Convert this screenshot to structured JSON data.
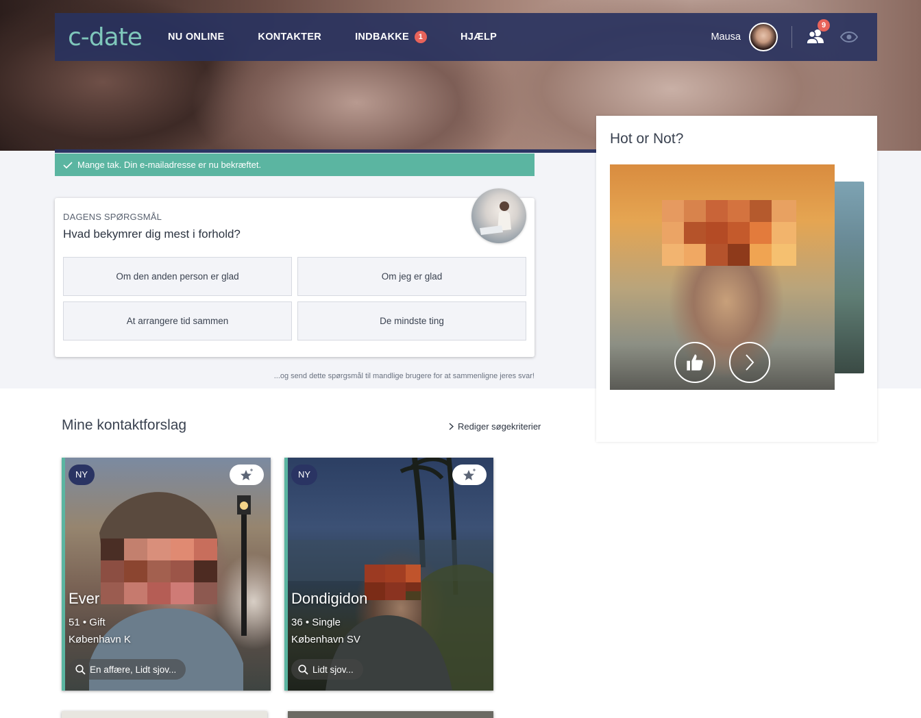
{
  "brand": {
    "logo": "c-date"
  },
  "nav": {
    "items": [
      {
        "label": "NU ONLINE"
      },
      {
        "label": "KONTAKTER"
      },
      {
        "label": "INDBAKKE",
        "badge": "1"
      },
      {
        "label": "HJÆLP"
      }
    ],
    "user_name": "Mausa",
    "contacts_badge": "9",
    "icons": [
      "contacts-icon",
      "eye-icon"
    ]
  },
  "success_banner": {
    "text": "Mange tak. Din e-mailadresse er nu bekræftet."
  },
  "question": {
    "label": "DAGENS SPØRGSMÅL",
    "text": "Hvad bekymrer dig mest i forhold?",
    "options": [
      "Om den anden person er glad",
      "Om jeg er glad",
      "At arrangere tid sammen",
      "De mindste ting"
    ],
    "footer": "...og send dette spørgsmål til mandlige brugere for at sammenligne jeres svar!"
  },
  "hot_or_not": {
    "title": "Hot or Not?",
    "buttons": [
      "thumbs-up-icon",
      "chevron-right-icon"
    ]
  },
  "suggestions": {
    "title": "Mine kontaktforslag",
    "edit_link": "Rediger søgekriterier",
    "cards": [
      {
        "badge": "NY",
        "name": "Ever",
        "meta": "51 • Gift",
        "city": "København K",
        "tag": "En affære, Lidt sjov..."
      },
      {
        "badge": "NY",
        "name": "Dondigidon",
        "meta": "36 • Single",
        "city": "København SV",
        "tag": "Lidt sjov..."
      }
    ]
  },
  "colors": {
    "navbar": "#28325f",
    "accent": "#5bb5a1",
    "badge": "#e8635a",
    "logo": "#7fc7bb"
  }
}
